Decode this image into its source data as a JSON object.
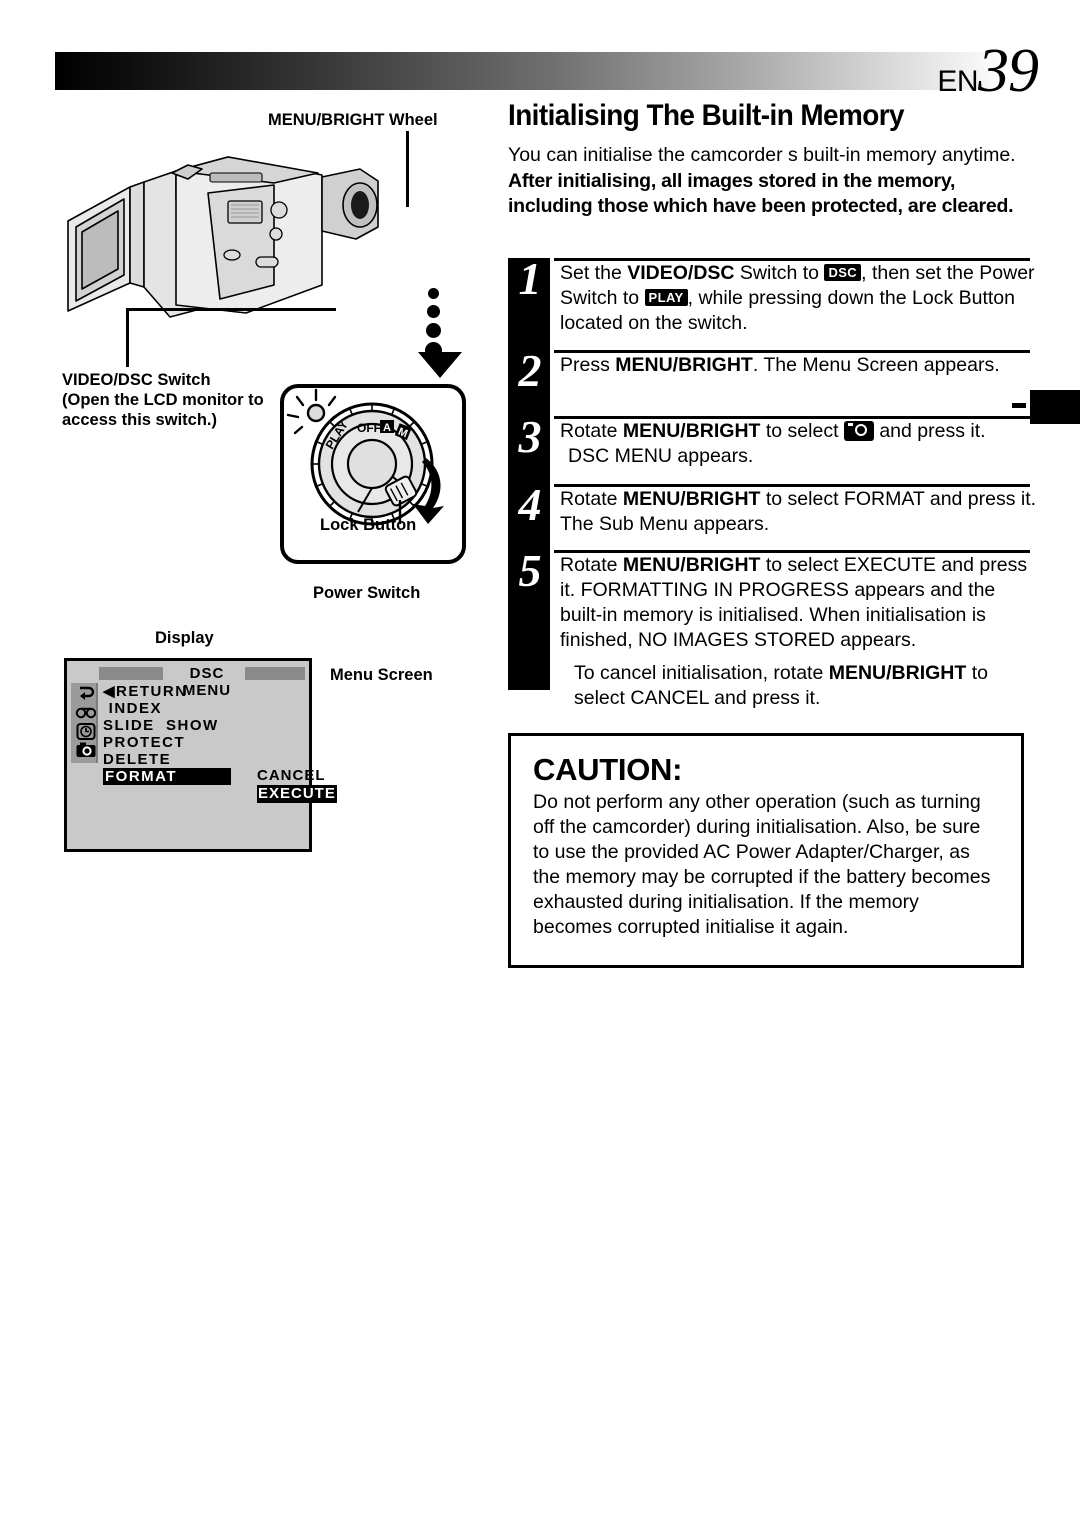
{
  "header": {
    "page_prefix": "EN",
    "page_number": "39"
  },
  "main": {
    "title": "Initialising The Built-in Memory",
    "intro": "You can initialise the camcorder s built-in memory anytime.",
    "intro_bold": "After initialising, all images stored in the memory, including those which have been protected, are cleared."
  },
  "steps": [
    {
      "number": "1",
      "text_1": "Set the ",
      "bold_1": "VIDEO/DSC",
      "text_2": " Switch to ",
      "badge_1": "DSC",
      "text_3": ", then set the Power Switch to ",
      "badge_2": "PLAY",
      "text_4": ", while pressing down the Lock Button located on the switch."
    },
    {
      "number": "2",
      "text_1": "Press ",
      "bold_1": "MENU/BRIGHT",
      "text_2": ". The Menu Screen appears."
    },
    {
      "number": "3",
      "text_1": "Rotate ",
      "bold_1": "MENU/BRIGHT",
      "text_2": " to select ",
      "icon": "camera-icon",
      "text_3": " and press it.",
      "text_4": "DSC MENU  appears."
    },
    {
      "number": "4",
      "text_1": "Rotate ",
      "bold_1": "MENU/BRIGHT",
      "text_2": " to select  FORMAT  and press it. The Sub Menu appears."
    },
    {
      "number": "5",
      "text_1": "Rotate ",
      "bold_1": "MENU/BRIGHT",
      "text_2": " to select  EXECUTE  and press it.  FORMATTING IN PROGRESS  appears and the built-in memory is initialised. When initialisation is finished,  NO IMAGES STORED  appears.",
      "sub_1": "To cancel initialisation, rotate ",
      "sub_bold": "MENU/BRIGHT",
      "sub_2": " to select  CANCEL  and press it."
    }
  ],
  "caution": {
    "heading": "CAUTION:",
    "body": "Do not perform any other operation (such as turning off the camcorder) during initialisation. Also, be sure to use the provided AC Power Adapter/Charger, as the memory may be corrupted if the battery becomes exhausted during initialisation. If the memory becomes corrupted initialise it again."
  },
  "figure_labels": {
    "menu_bright_wheel": "MENU/BRIGHT Wheel",
    "video_dsc_switch": "VIDEO/DSC Switch",
    "video_dsc_note": "(Open the LCD monitor to access this switch.)",
    "lock_button": "Lock Button",
    "power_switch": "Power Switch",
    "display": "Display",
    "menu_screen": "Menu Screen"
  },
  "power_dial": {
    "positions": [
      "PLAY",
      "OFF",
      "A",
      "M"
    ]
  },
  "display_screen": {
    "title": "DSC  MENU",
    "items": [
      "◀RETURN",
      " INDEX",
      "SLIDE  SHOW",
      "PROTECT",
      "DELETE",
      "FORMAT"
    ],
    "highlighted_item": "FORMAT",
    "sub_menu": [
      "CANCEL",
      "EXECUTE"
    ],
    "sub_menu_highlighted": "EXECUTE",
    "side_icons": [
      "return-icon",
      "tape-icon",
      "clock-icon",
      "camera-icon"
    ]
  },
  "colors": {
    "ink": "#000000",
    "display_bg": "#c9c9c9",
    "display_side": "#9b9b9b",
    "display_bar": "#8a8a8a"
  }
}
